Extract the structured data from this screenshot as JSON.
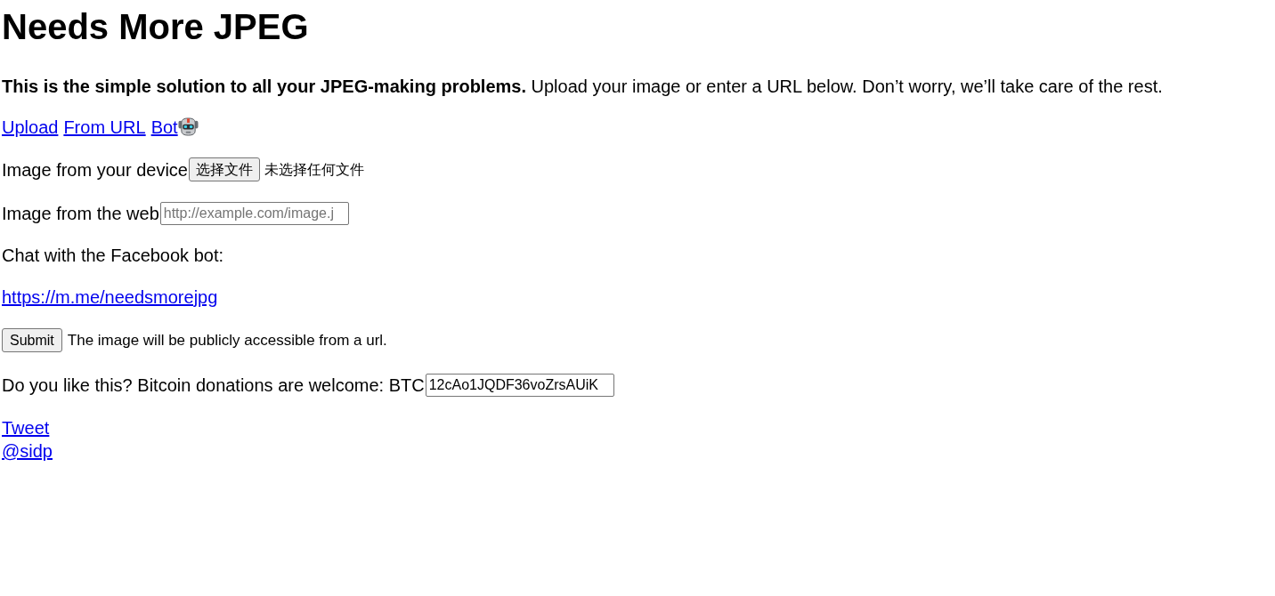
{
  "title": "Needs More JPEG",
  "intro": "**This is the simple solution to all your JPEG-making problems.** Upload your image or enter a URL below. Don’t worry, we’ll take care of the rest.",
  "source_links": [
    {
      "label": "Upload",
      "kind": "plain"
    },
    {
      "label": "From URL",
      "kind": "plain"
    },
    {
      "label": "Bot",
      "kind": "robot"
    }
  ],
  "device_field": {
    "label": "Image from your device",
    "button": "选择文件",
    "status": "未选择任何文件"
  },
  "web_field": {
    "label": "Image from the web",
    "placeholder": "http://example.com/image.j"
  },
  "bot": {
    "label": "Chat with the Facebook bot:",
    "link": "https://m.me/needsmorejpg"
  },
  "submit": {
    "button": "Submit",
    "note": "The image will be publicly accessible from a url."
  },
  "donation": {
    "label": "Do you like this? Bitcoin donations are welcome: BTC",
    "address": "12cAo1JQDF36voZrsAUiK"
  },
  "footer_links": [
    "Tweet",
    "@sidp"
  ]
}
